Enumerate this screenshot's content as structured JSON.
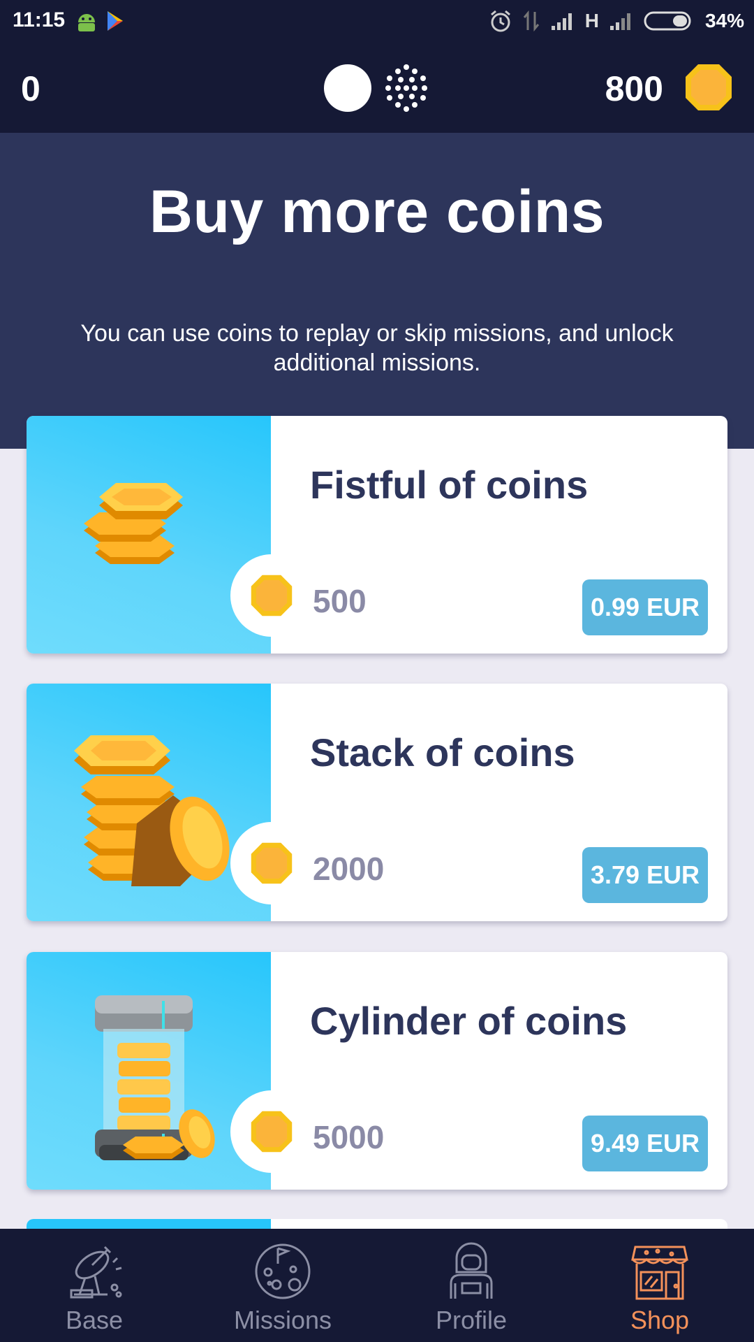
{
  "status_bar": {
    "time": "11:15",
    "network": "H",
    "battery_percent": "34%",
    "left_icons": [
      "android-icon",
      "play-store-icon"
    ],
    "right_icons": [
      "alarm-icon",
      "data-transfer-icon",
      "signal-icon",
      "signal-icon",
      "battery-icon"
    ]
  },
  "top_bar": {
    "left_count": "0",
    "coins_count": "800",
    "center_icons": [
      "moon-icon",
      "dots-cluster-icon"
    ],
    "coin_icon": "coin-icon"
  },
  "header": {
    "title": "Buy more coins",
    "description": "You can use coins to replay or skip missions, and unlock additional missions."
  },
  "offers": [
    {
      "title": "Fistful of coins",
      "amount": "500",
      "price": "0.99 EUR",
      "art": "coin-pile-icon"
    },
    {
      "title": "Stack of coins",
      "amount": "2000",
      "price": "3.79 EUR",
      "art": "coin-stack-icon"
    },
    {
      "title": "Cylinder of coins",
      "amount": "5000",
      "price": "9.49 EUR",
      "art": "coin-cylinder-icon"
    }
  ],
  "bottom_nav": {
    "items": [
      {
        "label": "Base",
        "icon": "satellite-dish-icon",
        "active": false
      },
      {
        "label": "Missions",
        "icon": "planet-flag-icon",
        "active": false
      },
      {
        "label": "Profile",
        "icon": "astronaut-icon",
        "active": false
      },
      {
        "label": "Shop",
        "icon": "shop-icon",
        "active": true
      }
    ]
  },
  "colors": {
    "bar_bg": "#151935",
    "header_bg": "#2d355b",
    "card_art_bg": "#27c6fb",
    "price_badge": "#5bb6de",
    "active_tab": "#f4915a",
    "inactive_tab": "#8c8fa5",
    "coin_gold": "#f7c21a"
  }
}
